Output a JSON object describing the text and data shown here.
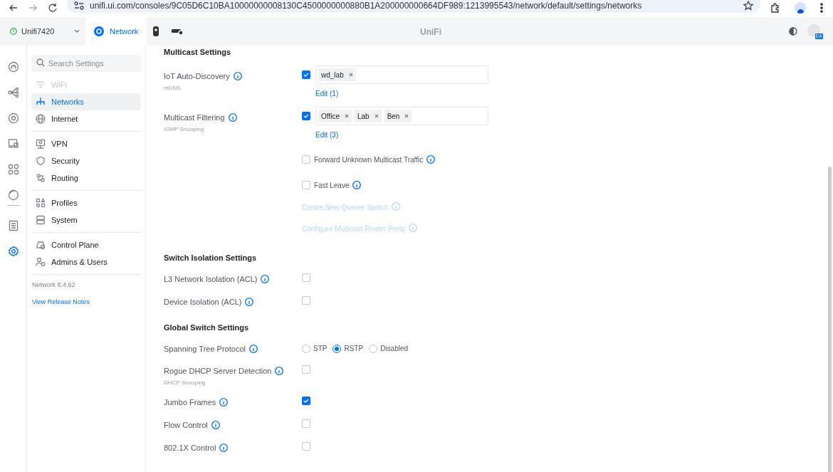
{
  "browser": {
    "url": "unifi.ui.com/consoles/9C05D6C10BA10000000008130C4500000000880B1A200000000664DF989:1213995543/network/default/settings/networks"
  },
  "header": {
    "console": "Unifi7420",
    "apps": [
      {
        "kind": "network",
        "label": "Network",
        "selected": true
      },
      {
        "kind": "camera",
        "selected": false
      },
      {
        "kind": "gateway",
        "selected": false
      }
    ],
    "brand": "UniFi",
    "badge": "EA"
  },
  "rail": [
    {
      "kind": "dashboard",
      "selected": false
    },
    {
      "kind": "topology",
      "selected": false
    },
    {
      "kind": "devices",
      "selected": false
    },
    {
      "kind": "clients",
      "selected": false
    },
    {
      "kind": "apps",
      "selected": false
    },
    {
      "kind": "insights",
      "selected": false
    },
    {
      "kind": "logs",
      "selected": false
    },
    {
      "kind": "settings",
      "selected": true
    }
  ],
  "sidebar": {
    "search_placeholder": "Search Settings",
    "groups": [
      [
        {
          "kind": "wifi",
          "label": "WiFi",
          "selected": false,
          "disabled": true
        },
        {
          "kind": "networks",
          "label": "Networks",
          "selected": true,
          "disabled": false
        },
        {
          "kind": "internet",
          "label": "Internet",
          "selected": false,
          "disabled": false
        }
      ],
      [
        {
          "kind": "vpn",
          "label": "VPN",
          "selected": false,
          "disabled": false
        },
        {
          "kind": "security",
          "label": "Security",
          "selected": false,
          "disabled": false
        },
        {
          "kind": "routing",
          "label": "Routing",
          "selected": false,
          "disabled": false
        }
      ],
      [
        {
          "kind": "profiles",
          "label": "Profiles",
          "selected": false,
          "disabled": false
        },
        {
          "kind": "system",
          "label": "System",
          "selected": false,
          "disabled": false
        }
      ],
      [
        {
          "kind": "control",
          "label": "Control Plane",
          "selected": false,
          "disabled": false
        },
        {
          "kind": "admins",
          "label": "Admins & Users",
          "selected": false,
          "disabled": false
        }
      ]
    ],
    "version": "Network 8.4.62",
    "release_notes": "View Release Notes"
  },
  "sections": [
    {
      "title": "Multicast Settings",
      "rows": [
        {
          "kind": "tags",
          "label": "IoT Auto-Discovery",
          "sublabel": "mDNS",
          "checked": true,
          "tags": [
            "wd_lab"
          ],
          "edit": "Edit (1)"
        },
        {
          "kind": "tags",
          "label": "Multicast Filtering",
          "sublabel": "IGMP Snooping",
          "checked": true,
          "tags": [
            "Office",
            "Lab",
            "Ben"
          ],
          "edit": "Edit (3)"
        },
        {
          "kind": "option",
          "text": "Forward Unknown Multicast Traffic",
          "checked": false
        },
        {
          "kind": "option",
          "text": "Fast Leave",
          "checked": false
        },
        {
          "kind": "link",
          "text": "Create New Querier Switch",
          "disabled": true
        },
        {
          "kind": "link",
          "text": "Configure Multicast Router Ports",
          "disabled": true
        }
      ]
    },
    {
      "title": "Switch Isolation Settings",
      "rows": [
        {
          "kind": "checkbox",
          "label": "L3 Network Isolation (ACL)",
          "checked": false
        },
        {
          "kind": "checkbox",
          "label": "Device Isolation (ACL)",
          "checked": false
        }
      ]
    },
    {
      "title": "Global Switch Settings",
      "rows": [
        {
          "kind": "radio",
          "label": "Spanning Tree Protocol",
          "options": [
            {
              "label": "STP",
              "selected": false
            },
            {
              "label": "RSTP",
              "selected": true
            },
            {
              "label": "Disabled",
              "selected": false
            }
          ]
        },
        {
          "kind": "checkbox",
          "label": "Rogue DHCP Server Detection",
          "sublabel": "DHCP Snooping",
          "checked": false
        },
        {
          "kind": "checkbox",
          "label": "Jumbo Frames",
          "checked": true
        },
        {
          "kind": "checkbox",
          "label": "Flow Control",
          "checked": false
        },
        {
          "kind": "checkbox",
          "label": "802.1X Control",
          "checked": false
        }
      ]
    }
  ]
}
